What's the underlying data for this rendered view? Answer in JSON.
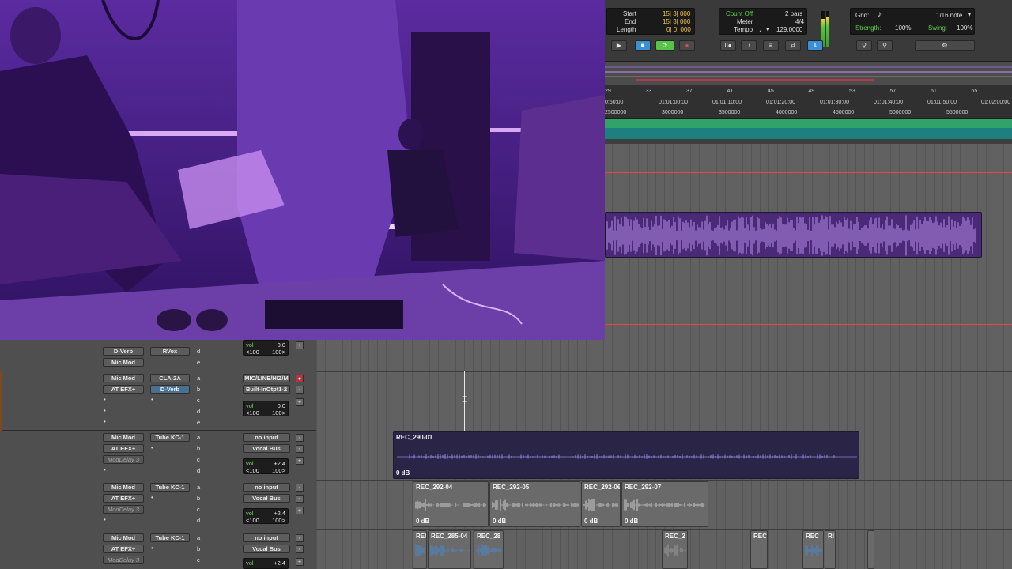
{
  "toolbar": {
    "start_label": "Start",
    "start_val": "15| 3| 000",
    "end_label": "End",
    "end_val": "15| 3| 000",
    "length_label": "Length",
    "length_val": "0| 0| 000",
    "countoff_label": "Count Off",
    "countoff_val": "2 bars",
    "meter_label": "Meter",
    "meter_val": "4/4",
    "tempo_label": "Tempo",
    "tempo_val": "129.0000",
    "grid_label": "Grid:",
    "grid_val": "1/16 note",
    "strength_label": "Strength:",
    "strength_val": "100%",
    "swing_label": "Swing:",
    "swing_val": "100%"
  },
  "ruler": {
    "bars": [
      "29",
      "33",
      "37",
      "41",
      "45",
      "49",
      "53",
      "57",
      "61",
      "65"
    ],
    "times": [
      "0:50:00",
      "01:01:00:00",
      "01:01:10:00",
      "01:01:20:00",
      "01:01:30:00",
      "01:01:40:00",
      "01:01:50:00",
      "01:02:00:00"
    ],
    "samples": [
      "2500000",
      "3000000",
      "3500000",
      "4000000",
      "4500000",
      "5000000",
      "5500000"
    ]
  },
  "mixer": {
    "rows": [
      {
        "inserts": [
          "D-Verb",
          "Mic Mod"
        ],
        "inserts2": [
          "RVox"
        ],
        "sends": [
          "d",
          "e"
        ],
        "io": [],
        "vol": "0.0",
        "pan_l": "<100",
        "pan_r": "100>"
      },
      {
        "inserts": [
          "Mic Mod",
          "AT EFX+"
        ],
        "inserts2": [
          "CLA-2A",
          "D-Verb"
        ],
        "sends": [
          "a",
          "b",
          "c",
          "d",
          "e"
        ],
        "io": [
          "MIC/LINE/HIZ/M",
          "Built-InOtpt1-2"
        ],
        "vol": "0.0",
        "pan_l": "<100",
        "pan_r": "100>"
      },
      {
        "inserts": [
          "Mic Mod",
          "AT EFX+",
          "ModDelay 3"
        ],
        "inserts2": [
          "Tube KC-1"
        ],
        "sends": [
          "a",
          "b",
          "c",
          "d"
        ],
        "io": [
          "no input",
          "Vocal Bus"
        ],
        "vol": "+2.4",
        "pan_l": "<100",
        "pan_r": "100>"
      },
      {
        "inserts": [
          "Mic Mod",
          "AT EFX+",
          "ModDelay 3"
        ],
        "inserts2": [
          "Tube KC-1"
        ],
        "sends": [
          "a",
          "b",
          "c",
          "d"
        ],
        "io": [
          "no input",
          "Vocal Bus"
        ],
        "vol": "+2.4",
        "pan_l": "<100",
        "pan_r": "100>"
      },
      {
        "inserts": [
          "Mic Mod",
          "AT EFX+",
          "ModDelay 3"
        ],
        "inserts2": [
          "Tube KC-1"
        ],
        "sends": [
          "a",
          "b",
          "c"
        ],
        "io": [
          "no input",
          "Vocal Bus"
        ],
        "vol": "+2.4"
      }
    ]
  },
  "clips": {
    "c1": {
      "name": "REC_290-01",
      "gain": "0 dB"
    },
    "c2": {
      "name": "REC_292-04",
      "gain": "0 dB"
    },
    "c3": {
      "name": "REC_292-05",
      "gain": "0 dB"
    },
    "c4": {
      "name": "REC_292-0€",
      "gain": "0 dB"
    },
    "c5": {
      "name": "REC_292-07",
      "gain": "0 dB"
    },
    "c6": {
      "name": "REC"
    },
    "c7": {
      "name": "REC_285-04"
    },
    "c8": {
      "name": "REC_28"
    },
    "c9": {
      "name": "REC_2"
    },
    "c10": {
      "name": "REC"
    },
    "c11": {
      "name": "REC"
    },
    "c12": {
      "name": "RI"
    }
  },
  "colors": {
    "accent_green": "#55c447",
    "accent_blue": "#3b8fd6",
    "clip_purple": "#4a2a78",
    "marker_green": "#2fa36a",
    "marker_teal": "#1d7f80",
    "selection_red": "#e0474d"
  },
  "icons": [
    "play-icon",
    "stop-icon",
    "loop-icon",
    "record-icon",
    "metronome-icon",
    "zoom-icon",
    "settings-icon",
    "note-icon",
    "insert-arrow-icon"
  ]
}
